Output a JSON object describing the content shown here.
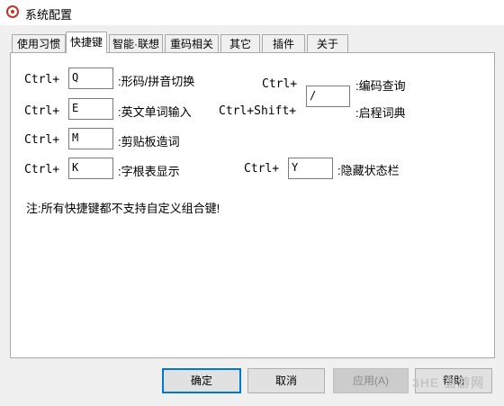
{
  "window": {
    "title": "系统配置",
    "icon": "app-logo-icon"
  },
  "tabs": [
    {
      "label": "使用习惯",
      "active": false
    },
    {
      "label": "快捷键",
      "active": true
    },
    {
      "label": "智能·联想",
      "active": false
    },
    {
      "label": "重码相关",
      "active": false
    },
    {
      "label": "其它",
      "active": false
    },
    {
      "label": "插件",
      "active": false
    },
    {
      "label": "关于",
      "active": false
    }
  ],
  "shortcuts": {
    "left": [
      {
        "prefix": "Ctrl+",
        "key": "Q",
        "desc": ":形码/拼音切换"
      },
      {
        "prefix": "Ctrl+",
        "key": "E",
        "desc": ":英文单词输入"
      },
      {
        "prefix": "Ctrl+",
        "key": "M",
        "desc": ":剪贴板造词"
      },
      {
        "prefix": "Ctrl+",
        "key": "K",
        "desc": ":字根表显示"
      }
    ],
    "right": [
      {
        "prefix": "Ctrl+",
        "desc": ":编码查询"
      },
      {
        "prefix": "Ctrl+Shift+",
        "key": "/",
        "desc": ":启程词典"
      },
      {
        "prefix": "Ctrl+",
        "key": "Y",
        "desc": ":隐藏状态栏"
      }
    ]
  },
  "note": "注:所有快捷键都不支持自定义组合键!",
  "buttons": {
    "ok": "确定",
    "cancel": "取消",
    "apply": "应用(A)",
    "help": "帮助"
  },
  "watermark": "3HE 当游网"
}
